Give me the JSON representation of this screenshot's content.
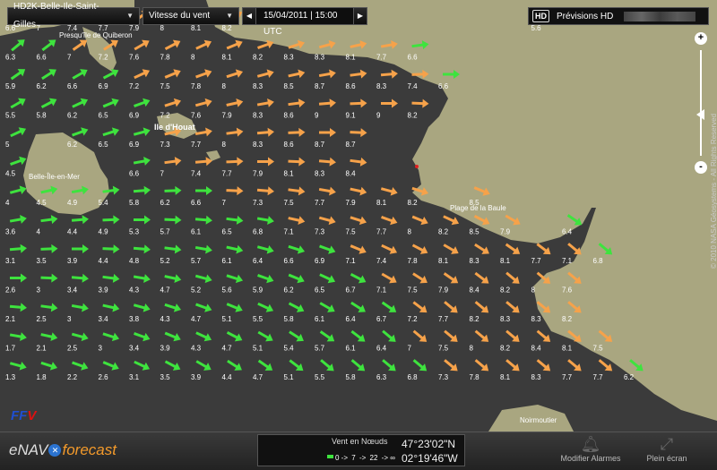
{
  "toolbar": {
    "zone": "HD2K-Belle-Ile-Saint-Gilles",
    "layer": "Vitesse du vent",
    "date": "15/04/2011 | 15:00 UTC",
    "prev_icon": "chevron-left-icon",
    "next_icon": "chevron-right-icon"
  },
  "hd": {
    "badge": "HD",
    "label": "Prévisions HD"
  },
  "zoom": {
    "plus": "+",
    "minus": "-"
  },
  "map": {
    "places": [
      "Presqu'île de Quiberon",
      "Ile d'Houat",
      "Belle-Île-en-Mer",
      "Plage de la Baule",
      "Noirmoutier"
    ],
    "credit": "© 2010 NASA Géosystems - All Rights Reserved",
    "colors": {
      "sea": "#3b3b3b",
      "land": "#a9a680",
      "green": "#3ee33e",
      "orange": "#f6a24a"
    },
    "rows": [
      [
        "6.6",
        "7",
        "7.4",
        "7.7",
        "7.9",
        "8",
        "8.1",
        "8.2",
        "",
        "",
        "",
        "",
        "",
        "",
        "",
        "",
        "",
        "5.6",
        "",
        "",
        ""
      ],
      [
        "6.3",
        "6.6",
        "7",
        "7.2",
        "7.6",
        "7.8",
        "8",
        "8.1",
        "8.2",
        "8.3",
        "8.3",
        "8.1",
        "7.7",
        "6.6",
        "",
        "",
        "",
        "",
        "",
        "",
        ""
      ],
      [
        "5.9",
        "6.2",
        "6.6",
        "6.9",
        "7.2",
        "7.5",
        "7.8",
        "8",
        "8.3",
        "8.5",
        "8.7",
        "8.6",
        "8.3",
        "7.4",
        "6.6",
        "",
        "",
        "",
        "",
        "",
        ""
      ],
      [
        "5.5",
        "5.8",
        "6.2",
        "6.5",
        "6.9",
        "7.2",
        "7.6",
        "7.9",
        "8.3",
        "8.6",
        "9",
        "9.1",
        "9",
        "8.2",
        "",
        "",
        "",
        "",
        "",
        "",
        ""
      ],
      [
        "5",
        "",
        "6.2",
        "6.5",
        "6.9",
        "7.3",
        "7.7",
        "8",
        "8.3",
        "8.6",
        "8.7",
        "8.7",
        "",
        "",
        "",
        "",
        "",
        "",
        "",
        "",
        ""
      ],
      [
        "4.5",
        "",
        "",
        "",
        "6.6",
        "7",
        "7.4",
        "7.7",
        "7.9",
        "8.1",
        "8.3",
        "8.4",
        "",
        "",
        "",
        "",
        "",
        "",
        "",
        "",
        ""
      ],
      [
        "4",
        "4.5",
        "4.9",
        "5.4",
        "5.8",
        "6.2",
        "6.6",
        "7",
        "7.3",
        "7.5",
        "7.7",
        "7.9",
        "8.1",
        "8.2",
        "",
        "8.5",
        "",
        "",
        "",
        "",
        ""
      ],
      [
        "3.6",
        "4",
        "4.4",
        "4.9",
        "5.3",
        "5.7",
        "6.1",
        "6.5",
        "6.8",
        "7.1",
        "7.3",
        "7.5",
        "7.7",
        "8",
        "8.2",
        "8.5",
        "7.9",
        "",
        "6.4",
        "",
        ""
      ],
      [
        "3.1",
        "3.5",
        "3.9",
        "4.4",
        "4.8",
        "5.2",
        "5.7",
        "6.1",
        "6.4",
        "6.6",
        "6.9",
        "7.1",
        "7.4",
        "7.8",
        "8.1",
        "8.3",
        "8.1",
        "7.7",
        "7.1",
        "6.8",
        ""
      ],
      [
        "2.6",
        "3",
        "3.4",
        "3.9",
        "4.3",
        "4.7",
        "5.2",
        "5.6",
        "5.9",
        "6.2",
        "6.5",
        "6.7",
        "7.1",
        "7.5",
        "7.9",
        "8.4",
        "8.2",
        "8",
        "7.6",
        "",
        ""
      ],
      [
        "2.1",
        "2.5",
        "3",
        "3.4",
        "3.8",
        "4.3",
        "4.7",
        "5.1",
        "5.5",
        "5.8",
        "6.1",
        "6.4",
        "6.7",
        "7.2",
        "7.7",
        "8.2",
        "8.3",
        "8.3",
        "8.2",
        "",
        ""
      ],
      [
        "1.7",
        "2.1",
        "2.5",
        "3",
        "3.4",
        "3.9",
        "4.3",
        "4.7",
        "5.1",
        "5.4",
        "5.7",
        "6.1",
        "6.4",
        "7",
        "7.5",
        "8",
        "8.2",
        "8.4",
        "8.1",
        "7.5",
        ""
      ],
      [
        "1.3",
        "1.8",
        "2.2",
        "2.6",
        "3.1",
        "3.5",
        "3.9",
        "4.4",
        "4.7",
        "5.1",
        "5.5",
        "5.8",
        "6.3",
        "6.8",
        "7.3",
        "7.8",
        "8.1",
        "8.3",
        "7.7",
        "7.7",
        "6.2"
      ]
    ]
  },
  "bottom": {
    "logo_pre": "eNAV",
    "logo_icon": "enav-icon",
    "logo_post": "forecast",
    "legend_title": "Vent en Nœuds",
    "scale": [
      "0 ->",
      "7",
      "->",
      "22",
      "-> ∞"
    ],
    "lat": "47°23'02\"N",
    "lon": "02°19'46\"W",
    "alarm_label": "Modifier Alarmes",
    "fullscreen_label": "Plein écran"
  },
  "ffv": {
    "text": "FF",
    "accent": "V"
  }
}
